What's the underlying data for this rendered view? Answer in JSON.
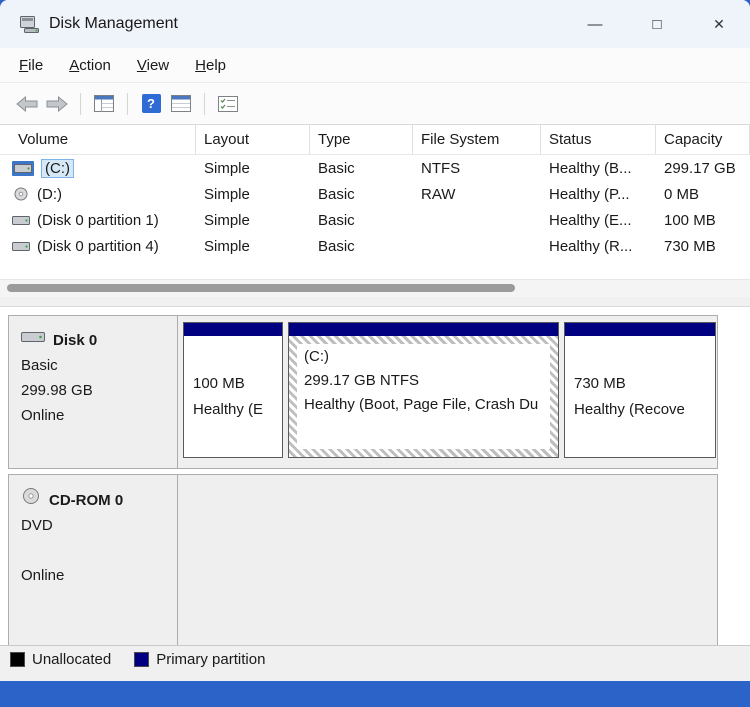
{
  "window": {
    "title": "Disk Management",
    "minimize_glyph": "—",
    "maximize_glyph": "□",
    "close_glyph": "✕"
  },
  "menubar": {
    "items": [
      {
        "label": "File"
      },
      {
        "label": "Action"
      },
      {
        "label": "View"
      },
      {
        "label": "Help"
      }
    ]
  },
  "toolbar": {
    "help_glyph": "?",
    "icons": [
      "back-arrow",
      "forward-arrow",
      "show-console-tree",
      "help",
      "show-details",
      "customize-view"
    ]
  },
  "volume_list": {
    "columns": [
      "Volume",
      "Layout",
      "Type",
      "File System",
      "Status",
      "Capacity"
    ],
    "rows": [
      {
        "volume": "(C:)",
        "layout": "Simple",
        "type": "Basic",
        "file_system": "NTFS",
        "status": "Healthy (B...",
        "capacity": "299.17 GB",
        "selected": true,
        "icon": "disk"
      },
      {
        "volume": "(D:)",
        "layout": "Simple",
        "type": "Basic",
        "file_system": "RAW",
        "status": "Healthy (P...",
        "capacity": "0 MB",
        "selected": false,
        "icon": "cd"
      },
      {
        "volume": "(Disk 0 partition 1)",
        "layout": "Simple",
        "type": "Basic",
        "file_system": "",
        "status": "Healthy (E...",
        "capacity": "100 MB",
        "selected": false,
        "icon": "disk"
      },
      {
        "volume": "(Disk 0 partition 4)",
        "layout": "Simple",
        "type": "Basic",
        "file_system": "",
        "status": "Healthy (R...",
        "capacity": "730 MB",
        "selected": false,
        "icon": "disk"
      }
    ]
  },
  "graphical_view": {
    "disk0": {
      "name": "Disk 0",
      "type": "Basic",
      "size": "299.98 GB",
      "status": "Online",
      "partitions": [
        {
          "size": "100 MB",
          "status": "Healthy (E"
        },
        {
          "name": "(C:)",
          "size": "299.17 GB NTFS",
          "status": "Healthy (Boot, Page File, Crash Du",
          "selected": true
        },
        {
          "size": "730 MB",
          "status": "Healthy (Recove"
        }
      ]
    },
    "cdrom0": {
      "name": "CD-ROM 0",
      "type": "DVD",
      "status": "Online"
    }
  },
  "legend": {
    "items": [
      {
        "label": "Unallocated",
        "color": "#000000"
      },
      {
        "label": "Primary partition",
        "color": "#000080"
      }
    ]
  },
  "colors": {
    "partition_header": "#000080",
    "desktop_background": "#2B63C8",
    "selection_highlight": "#3B76C8"
  }
}
